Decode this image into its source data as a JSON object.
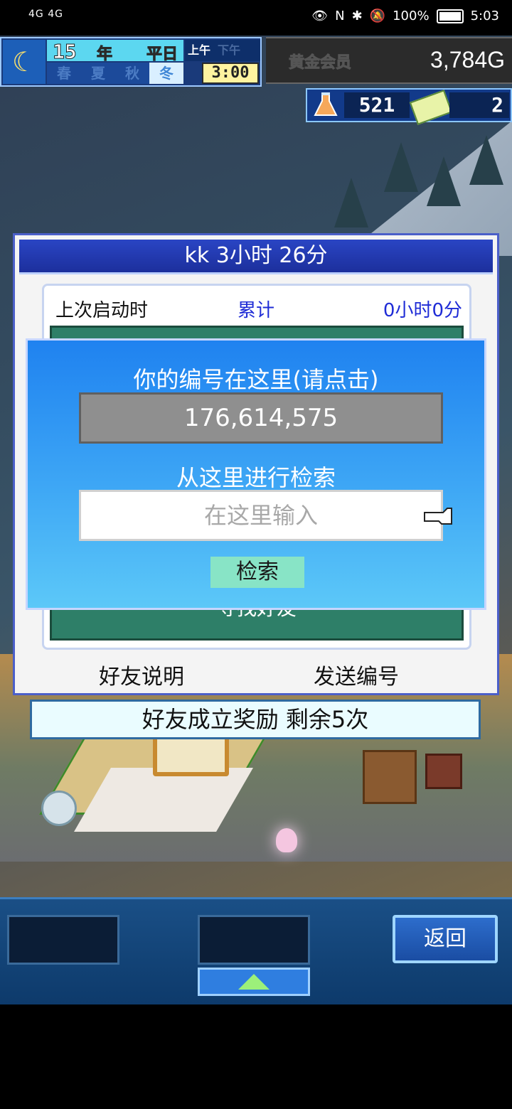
{
  "status_bar": {
    "signal": "4G 4G",
    "battery": "100%",
    "time": "5:03"
  },
  "hud": {
    "year": "15",
    "year_unit": "年",
    "weekday": "平日",
    "seasons": [
      "春",
      "夏",
      "秋",
      "冬"
    ],
    "active_season": "冬",
    "am": "上午",
    "pm": "下午",
    "clock": "3:00",
    "gold_label": "黄金会员",
    "money": "3,784G",
    "research_points": "521",
    "tickets": "2"
  },
  "panel": {
    "title": "kk  3小时 26分",
    "last_start_label": "上次启动时",
    "total_label": "累计",
    "total_value": "0小时0分",
    "find_friend": "寻找好友",
    "friend_desc": "好友说明",
    "send_number": "发送编号"
  },
  "bonus": "好友成立奖励  剩余5次",
  "dialog": {
    "title": "你的编号在这里(请点击)",
    "id_number": "176,614,575",
    "search_title": "从这里进行检索",
    "input_placeholder": "在这里输入",
    "search_button": "检索"
  },
  "bottom": {
    "back_button": "返回"
  }
}
